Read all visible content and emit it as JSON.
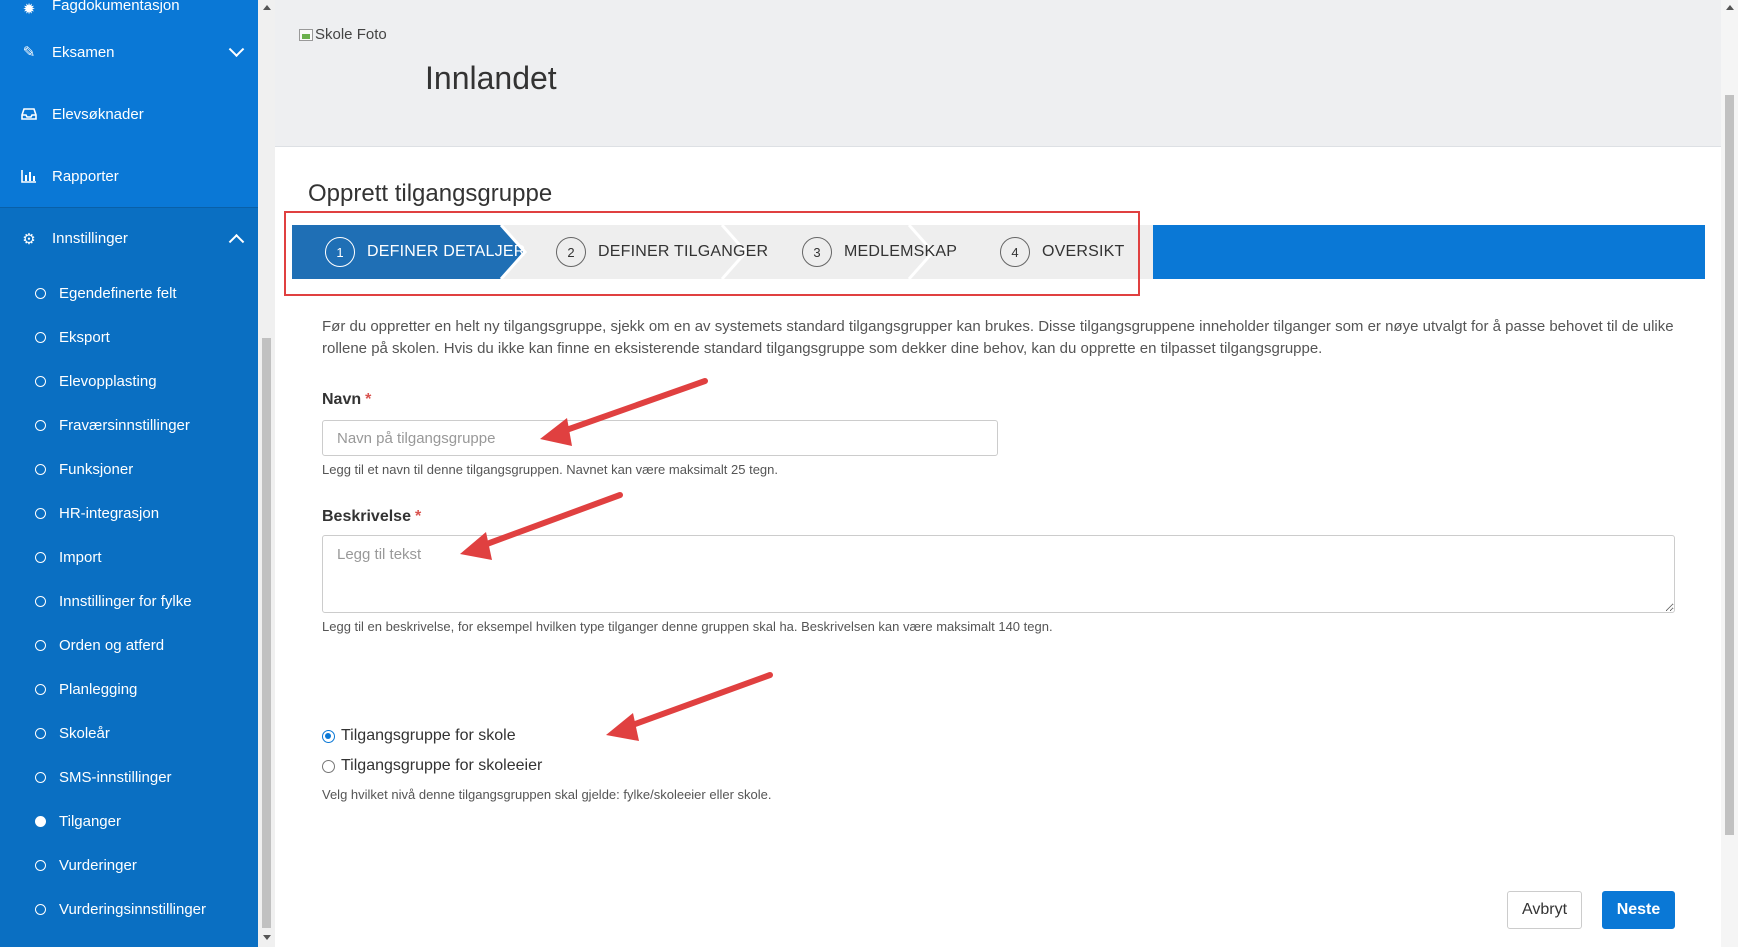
{
  "sidebar": {
    "items": [
      {
        "label": "Fagdokumentasjon",
        "icon": "gear-icon"
      },
      {
        "label": "Eksamen",
        "icon": "edit-icon"
      },
      {
        "label": "Elevsøknader",
        "icon": "inbox-icon"
      },
      {
        "label": "Rapporter",
        "icon": "bar-chart-icon"
      },
      {
        "label": "Innstillinger",
        "icon": "gear-icon"
      }
    ],
    "sub_items": [
      {
        "label": "Egendefinerte felt"
      },
      {
        "label": "Eksport"
      },
      {
        "label": "Elevopplasting"
      },
      {
        "label": "Fraværsinnstillinger"
      },
      {
        "label": "Funksjoner"
      },
      {
        "label": "HR-integrasjon"
      },
      {
        "label": "Import"
      },
      {
        "label": "Innstillinger for fylke"
      },
      {
        "label": "Orden og atferd"
      },
      {
        "label": "Planlegging"
      },
      {
        "label": "Skoleår"
      },
      {
        "label": "SMS-innstillinger"
      },
      {
        "label": "Tilganger",
        "active": true
      },
      {
        "label": "Vurderinger"
      },
      {
        "label": "Vurderingsinnstillinger"
      }
    ]
  },
  "header": {
    "photo_alt": "Skole Foto",
    "title": "Innlandet"
  },
  "page": {
    "title": "Opprett tilgangsgruppe",
    "intro": "Før du oppretter en helt ny tilgangsgruppe, sjekk om en av systemets standard tilgangsgrupper kan brukes. Disse tilgangsgruppene inneholder tilganger som er nøye utvalgt for å passe behovet til de ulike rollene på skolen. Hvis du ikke kan finne en eksisterende standard tilgangsgruppe som dekker dine behov, kan du opprette en tilpasset tilgangsgruppe."
  },
  "stepper": {
    "steps": [
      {
        "num": "1",
        "label": "DEFINER DETALJER",
        "active": true
      },
      {
        "num": "2",
        "label": "DEFINER TILGANGER"
      },
      {
        "num": "3",
        "label": "MEDLEMSKAP"
      },
      {
        "num": "4",
        "label": "OVERSIKT"
      }
    ]
  },
  "form": {
    "name_label": "Navn",
    "required_mark": "*",
    "name_placeholder": "Navn på tilgangsgruppe",
    "name_value": "",
    "name_help": "Legg til et navn til denne tilgangsgruppen. Navnet kan være maksimalt 25 tegn.",
    "desc_label": "Beskrivelse",
    "desc_placeholder": "Legg til tekst",
    "desc_value": "",
    "desc_help": "Legg til en beskrivelse, for eksempel hvilken type tilganger denne gruppen skal ha. Beskrivelsen kan være maksimalt 140 tegn.",
    "radio_school": "Tilgangsgruppe for skole",
    "radio_owner": "Tilgangsgruppe for skoleeier",
    "radio_selected": "school",
    "level_help": "Velg hvilket nivå denne tilgangsgruppen skal gjelde: fylke/skoleeier eller skole."
  },
  "buttons": {
    "cancel": "Avbryt",
    "next": "Neste"
  },
  "colors": {
    "sidebar": "#0a6fc2",
    "accent": "#0a78d6",
    "step_active": "#1f6fb5",
    "step_inactive": "#eeeeee",
    "annotation": "#e04040"
  }
}
